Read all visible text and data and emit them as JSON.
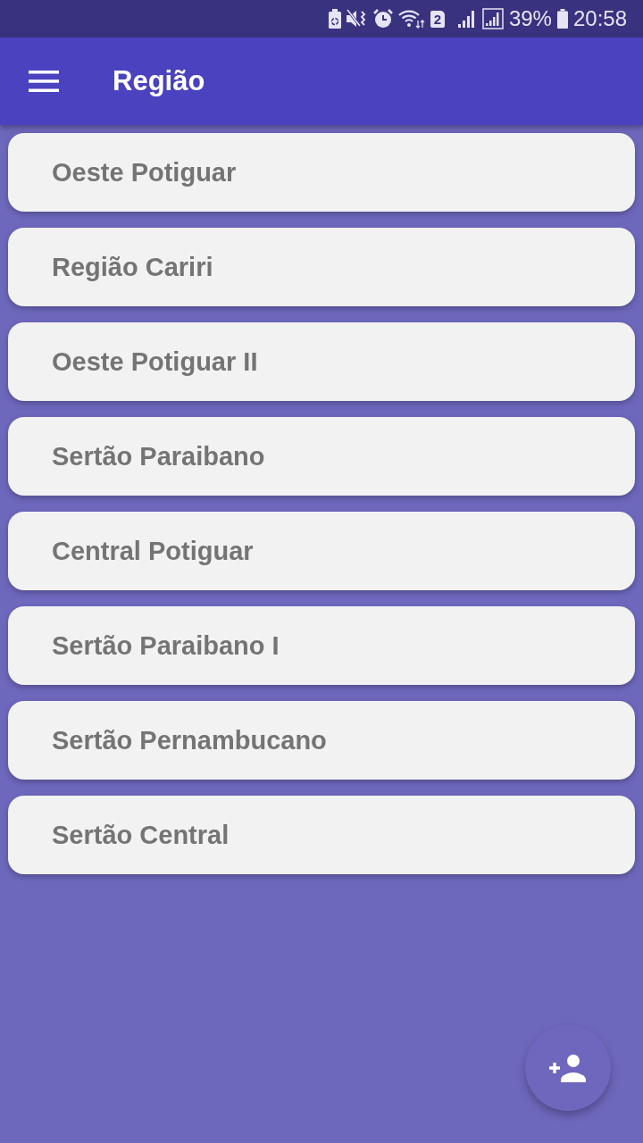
{
  "status_bar": {
    "sim_badge": "2",
    "battery_percent": "39%",
    "time": "20:58"
  },
  "app_bar": {
    "title": "Região"
  },
  "regions": [
    {
      "name": "Oeste Potiguar"
    },
    {
      "name": "Região Cariri"
    },
    {
      "name": "Oeste Potiguar II"
    },
    {
      "name": "Sertão Paraibano"
    },
    {
      "name": "Central Potiguar"
    },
    {
      "name": "Sertão Paraibano I"
    },
    {
      "name": "Sertão Pernambucano"
    },
    {
      "name": "Sertão Central"
    }
  ]
}
